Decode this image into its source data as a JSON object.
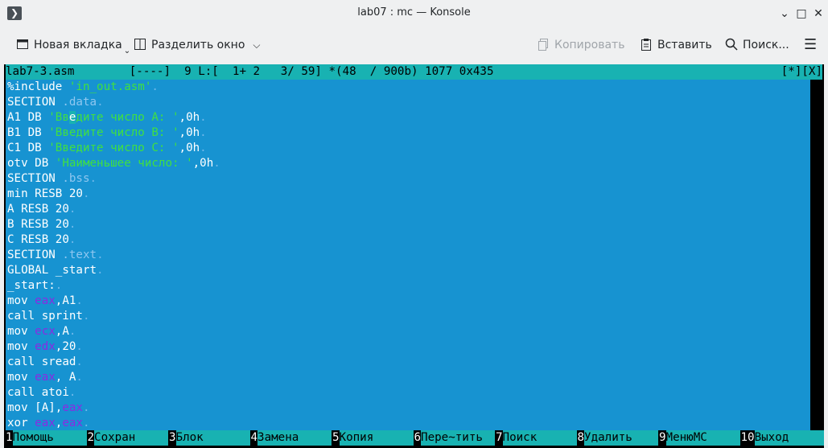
{
  "window": {
    "title": "lab07 : mc — Konsole"
  },
  "toolbar": {
    "new_tab": "Новая вкладка",
    "split": "Разделить окно",
    "copy": "Копировать",
    "paste": "Вставить",
    "search": "Поиск..."
  },
  "status": {
    "file": "lab7-3.asm",
    "mode": "[----]",
    "col": "9",
    "pos": "L:[  1+ 2   3/ 59]",
    "size": "*(48  / 900b)",
    "char": "1077 0x435",
    "flags": "[*][X]"
  },
  "fkeys": [
    {
      "n": "1",
      "l": "Помощь"
    },
    {
      "n": "2",
      "l": "Сохран"
    },
    {
      "n": "3",
      "l": "Блок"
    },
    {
      "n": "4",
      "l": "Замена"
    },
    {
      "n": "5",
      "l": "Копия"
    },
    {
      "n": "6",
      "l": "Пере~тить"
    },
    {
      "n": "7",
      "l": "Поиск"
    },
    {
      "n": "8",
      "l": "Удалить"
    },
    {
      "n": "9",
      "l": "МенюMC"
    },
    {
      "n": "10",
      "l": "Выход"
    }
  ],
  "colors": {
    "editor_bg": "#1793d1",
    "status_bg": "#18b2b2",
    "string": "#40e040",
    "register": "#8a2be2"
  },
  "code": [
    "%include 'in_out.asm'",
    "SECTION .data",
    "A1 DB 'Введите число A: ',0h",
    "B1 DB 'Введите число B: ',0h",
    "C1 DB 'Введите число C: ',0h",
    "otv DB 'Наименьшее число: ',0h",
    "SECTION .bss",
    "min RESB 20",
    "A RESB 20",
    "B RESB 20",
    "C RESB 20",
    "SECTION .text",
    "GLOBAL _start",
    "_start:",
    "mov eax,A1",
    "call sprint",
    "mov ecx,A",
    "mov edx,20",
    "call sread",
    "mov eax, A",
    "call atoi",
    "mov [A],eax",
    "xor eax,eax"
  ]
}
